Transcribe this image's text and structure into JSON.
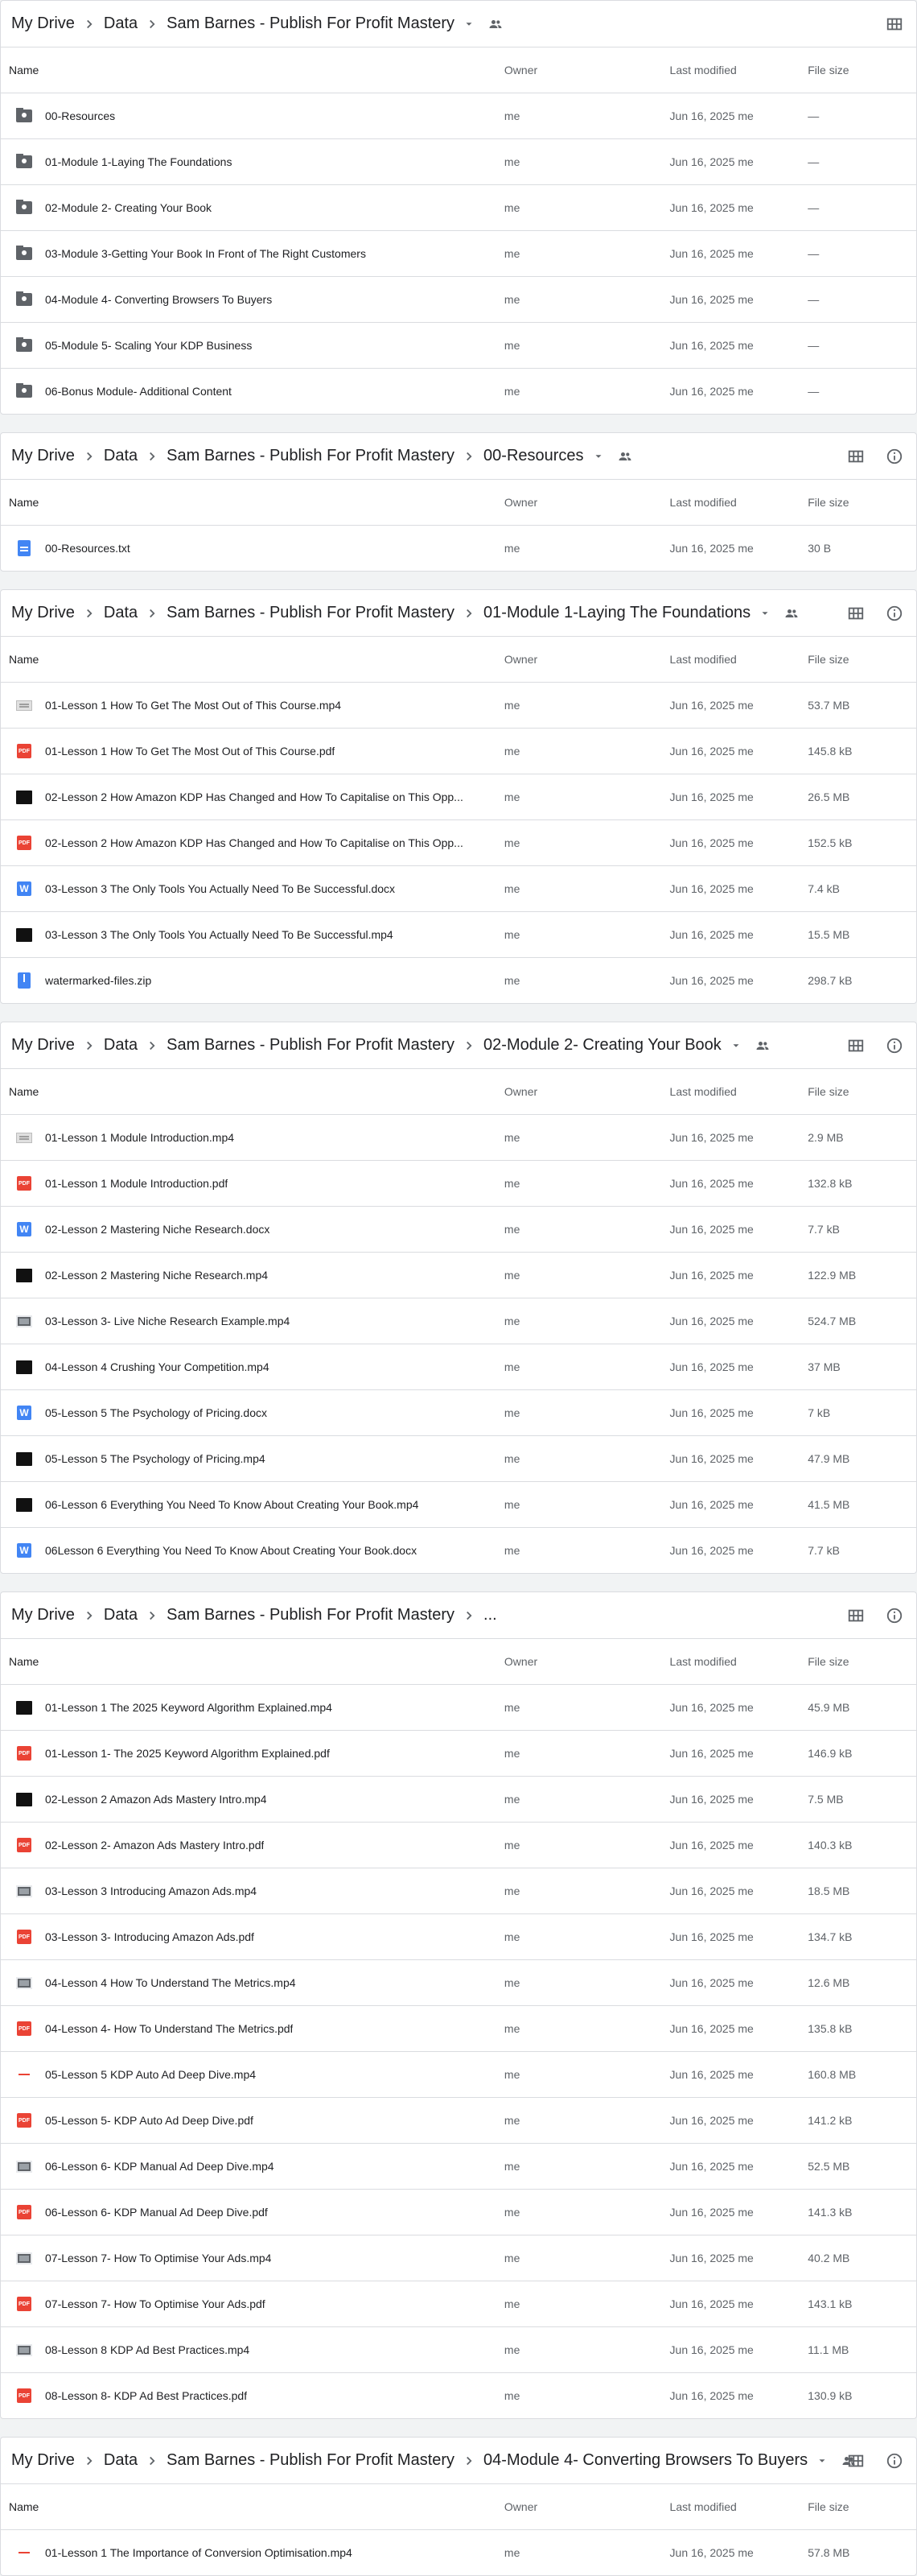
{
  "header": {
    "name_col": "Name",
    "owner_col": "Owner",
    "modified_col": "Last modified",
    "size_col": "File size"
  },
  "icons": {
    "chevron_right": "chevron-right-icon",
    "dropdown": "arrow-drop-down-icon",
    "shared": "people-icon",
    "grid": "grid-view-icon",
    "info": "info-icon"
  },
  "panels": [
    {
      "breadcrumbs": [
        "My Drive",
        "Data",
        "Sam Barnes - Publish For Profit Mastery"
      ],
      "show_dropdown": true,
      "show_shared": true,
      "show_info": false,
      "rows": [
        {
          "icon": "folder",
          "name": "00-Resources",
          "owner": "me",
          "modified": "Jun 16, 2025 me",
          "size": "—"
        },
        {
          "icon": "folder",
          "name": "01-Module 1-Laying The Foundations",
          "owner": "me",
          "modified": "Jun 16, 2025 me",
          "size": "—"
        },
        {
          "icon": "folder",
          "name": "02-Module 2- Creating Your Book",
          "owner": "me",
          "modified": "Jun 16, 2025 me",
          "size": "—"
        },
        {
          "icon": "folder",
          "name": "03-Module 3-Getting Your Book In Front of The Right Customers",
          "owner": "me",
          "modified": "Jun 16, 2025 me",
          "size": "—"
        },
        {
          "icon": "folder",
          "name": "04-Module 4- Converting Browsers To Buyers",
          "owner": "me",
          "modified": "Jun 16, 2025 me",
          "size": "—"
        },
        {
          "icon": "folder",
          "name": "05-Module 5- Scaling Your KDP Business",
          "owner": "me",
          "modified": "Jun 16, 2025 me",
          "size": "—"
        },
        {
          "icon": "folder",
          "name": "06-Bonus Module- Additional Content",
          "owner": "me",
          "modified": "Jun 16, 2025 me",
          "size": "—"
        }
      ]
    },
    {
      "breadcrumbs": [
        "My Drive",
        "Data",
        "Sam Barnes - Publish For Profit Mastery",
        "00-Resources"
      ],
      "show_dropdown": true,
      "show_shared": true,
      "show_info": true,
      "rows": [
        {
          "icon": "txt",
          "name": "00-Resources.txt",
          "owner": "me",
          "modified": "Jun 16, 2025 me",
          "size": "30 B"
        }
      ]
    },
    {
      "breadcrumbs": [
        "My Drive",
        "Data",
        "Sam Barnes - Publish For Profit Mastery",
        "01-Module 1-Laying The Foundations"
      ],
      "show_dropdown": true,
      "show_shared": true,
      "show_info": true,
      "rows": [
        {
          "icon": "vid-light",
          "name": "01-Lesson 1 How To Get The Most Out of This Course.mp4",
          "owner": "me",
          "modified": "Jun 16, 2025 me",
          "size": "53.7 MB"
        },
        {
          "icon": "pdf",
          "name": "01-Lesson 1 How To Get The Most Out of This Course.pdf",
          "owner": "me",
          "modified": "Jun 16, 2025 me",
          "size": "145.8 kB"
        },
        {
          "icon": "vid-dark",
          "name": "02-Lesson 2 How Amazon KDP Has Changed and How To Capitalise on This Opp...",
          "owner": "me",
          "modified": "Jun 16, 2025 me",
          "size": "26.5 MB"
        },
        {
          "icon": "pdf",
          "name": "02-Lesson 2 How Amazon KDP Has Changed and How To Capitalise on This Opp...",
          "owner": "me",
          "modified": "Jun 16, 2025 me",
          "size": "152.5 kB"
        },
        {
          "icon": "doc",
          "name": "03-Lesson 3 The Only Tools You Actually Need To Be Successful.docx",
          "owner": "me",
          "modified": "Jun 16, 2025 me",
          "size": "7.4 kB"
        },
        {
          "icon": "vid-dark",
          "name": "03-Lesson 3 The Only Tools You Actually Need To Be Successful.mp4",
          "owner": "me",
          "modified": "Jun 16, 2025 me",
          "size": "15.5 MB"
        },
        {
          "icon": "zip",
          "name": "watermarked-files.zip",
          "owner": "me",
          "modified": "Jun 16, 2025 me",
          "size": "298.7 kB"
        }
      ]
    },
    {
      "breadcrumbs": [
        "My Drive",
        "Data",
        "Sam Barnes - Publish For Profit Mastery",
        "02-Module 2- Creating Your Book"
      ],
      "show_dropdown": true,
      "show_shared": true,
      "show_info": true,
      "rows": [
        {
          "icon": "vid-light",
          "name": "01-Lesson 1 Module Introduction.mp4",
          "owner": "me",
          "modified": "Jun 16, 2025 me",
          "size": "2.9 MB"
        },
        {
          "icon": "pdf",
          "name": "01-Lesson 1 Module Introduction.pdf",
          "owner": "me",
          "modified": "Jun 16, 2025 me",
          "size": "132.8 kB"
        },
        {
          "icon": "doc",
          "name": "02-Lesson 2 Mastering Niche Research.docx",
          "owner": "me",
          "modified": "Jun 16, 2025 me",
          "size": "7.7 kB"
        },
        {
          "icon": "vid-dark",
          "name": "02-Lesson 2 Mastering Niche Research.mp4",
          "owner": "me",
          "modified": "Jun 16, 2025 me",
          "size": "122.9 MB"
        },
        {
          "icon": "vid-gray",
          "name": "03-Lesson 3- Live Niche Research Example.mp4",
          "owner": "me",
          "modified": "Jun 16, 2025 me",
          "size": "524.7 MB"
        },
        {
          "icon": "vid-dark",
          "name": "04-Lesson 4 Crushing Your Competition.mp4",
          "owner": "me",
          "modified": "Jun 16, 2025 me",
          "size": "37 MB"
        },
        {
          "icon": "doc",
          "name": "05-Lesson 5 The Psychology of Pricing.docx",
          "owner": "me",
          "modified": "Jun 16, 2025 me",
          "size": "7 kB"
        },
        {
          "icon": "vid-dark",
          "name": "05-Lesson 5 The Psychology of Pricing.mp4",
          "owner": "me",
          "modified": "Jun 16, 2025 me",
          "size": "47.9 MB"
        },
        {
          "icon": "vid-dark",
          "name": "06-Lesson 6 Everything You Need To Know About Creating Your Book.mp4",
          "owner": "me",
          "modified": "Jun 16, 2025 me",
          "size": "41.5 MB"
        },
        {
          "icon": "doc",
          "name": "06Lesson 6 Everything You Need To Know About Creating Your Book.docx",
          "owner": "me",
          "modified": "Jun 16, 2025 me",
          "size": "7.7 kB"
        }
      ]
    },
    {
      "breadcrumbs": [
        "My Drive",
        "Data",
        "Sam Barnes - Publish For Profit Mastery",
        "..."
      ],
      "show_dropdown": false,
      "show_shared": false,
      "show_info": true,
      "rows": [
        {
          "icon": "vid-dark",
          "name": "01-Lesson 1 The 2025 Keyword Algorithm Explained.mp4",
          "owner": "me",
          "modified": "Jun 16, 2025 me",
          "size": "45.9 MB"
        },
        {
          "icon": "pdf",
          "name": "01-Lesson 1- The 2025 Keyword Algorithm Explained.pdf",
          "owner": "me",
          "modified": "Jun 16, 2025 me",
          "size": "146.9 kB"
        },
        {
          "icon": "vid-dark",
          "name": "02-Lesson 2 Amazon Ads Mastery Intro.mp4",
          "owner": "me",
          "modified": "Jun 16, 2025 me",
          "size": "7.5 MB"
        },
        {
          "icon": "pdf",
          "name": "02-Lesson 2- Amazon Ads Mastery Intro.pdf",
          "owner": "me",
          "modified": "Jun 16, 2025 me",
          "size": "140.3 kB"
        },
        {
          "icon": "vid-gray",
          "name": "03-Lesson 3 Introducing Amazon Ads.mp4",
          "owner": "me",
          "modified": "Jun 16, 2025 me",
          "size": "18.5 MB"
        },
        {
          "icon": "pdf",
          "name": "03-Lesson 3- Introducing Amazon Ads.pdf",
          "owner": "me",
          "modified": "Jun 16, 2025 me",
          "size": "134.7 kB"
        },
        {
          "icon": "vid-gray",
          "name": "04-Lesson 4 How To Understand The Metrics.mp4",
          "owner": "me",
          "modified": "Jun 16, 2025 me",
          "size": "12.6 MB"
        },
        {
          "icon": "pdf",
          "name": "04-Lesson 4- How To Understand The Metrics.pdf",
          "owner": "me",
          "modified": "Jun 16, 2025 me",
          "size": "135.8 kB"
        },
        {
          "icon": "vid-red",
          "name": "05-Lesson 5 KDP Auto Ad Deep Dive.mp4",
          "owner": "me",
          "modified": "Jun 16, 2025 me",
          "size": "160.8 MB"
        },
        {
          "icon": "pdf",
          "name": "05-Lesson 5- KDP Auto Ad Deep Dive.pdf",
          "owner": "me",
          "modified": "Jun 16, 2025 me",
          "size": "141.2 kB"
        },
        {
          "icon": "vid-gray",
          "name": "06-Lesson 6- KDP Manual Ad Deep Dive.mp4",
          "owner": "me",
          "modified": "Jun 16, 2025 me",
          "size": "52.5 MB"
        },
        {
          "icon": "pdf",
          "name": "06-Lesson 6- KDP Manual Ad Deep Dive.pdf",
          "owner": "me",
          "modified": "Jun 16, 2025 me",
          "size": "141.3 kB"
        },
        {
          "icon": "vid-gray",
          "name": "07-Lesson 7- How To Optimise Your Ads.mp4",
          "owner": "me",
          "modified": "Jun 16, 2025 me",
          "size": "40.2 MB"
        },
        {
          "icon": "pdf",
          "name": "07-Lesson 7- How To Optimise Your Ads.pdf",
          "owner": "me",
          "modified": "Jun 16, 2025 me",
          "size": "143.1 kB"
        },
        {
          "icon": "vid-gray",
          "name": "08-Lesson 8 KDP Ad Best Practices.mp4",
          "owner": "me",
          "modified": "Jun 16, 2025 me",
          "size": "11.1 MB"
        },
        {
          "icon": "pdf",
          "name": "08-Lesson 8- KDP Ad Best Practices.pdf",
          "owner": "me",
          "modified": "Jun 16, 2025 me",
          "size": "130.9 kB"
        }
      ]
    },
    {
      "breadcrumbs": [
        "My Drive",
        "Data",
        "Sam Barnes - Publish For Profit Mastery",
        "04-Module 4- Converting Browsers To Buyers"
      ],
      "show_dropdown": true,
      "show_shared": true,
      "show_info": true,
      "rows": [
        {
          "icon": "vid-red",
          "name": "01-Lesson 1 The Importance of Conversion Optimisation.mp4",
          "owner": "me",
          "modified": "Jun 16, 2025 me",
          "size": "57.8 MB"
        }
      ]
    }
  ]
}
